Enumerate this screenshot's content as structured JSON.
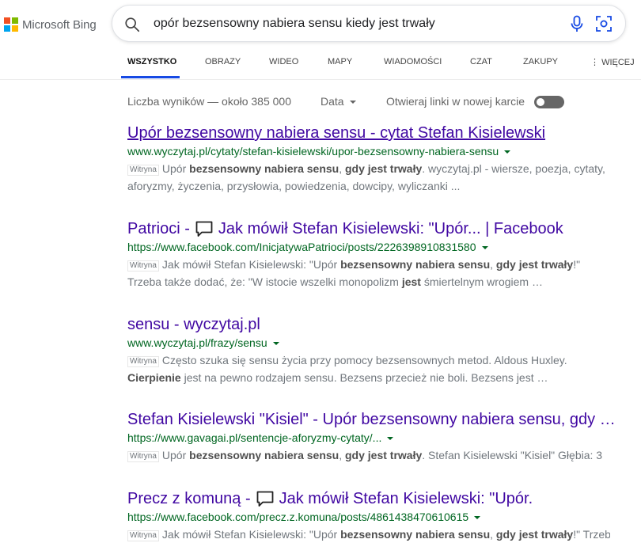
{
  "brand": {
    "name": "Microsoft Bing",
    "colors": [
      "#f25022",
      "#7fba00",
      "#00a4ef",
      "#ffb900"
    ]
  },
  "search": {
    "query": "opór bezsensowny nabiera sensu kiedy jest trwały",
    "icons": [
      "search-icon",
      "microphone-icon",
      "visual-search-icon"
    ]
  },
  "tabs": [
    {
      "label": "WSZYSTKO",
      "active": true
    },
    {
      "label": "OBRAZY"
    },
    {
      "label": "WIDEO"
    },
    {
      "label": "MAPY"
    },
    {
      "label": "WIADOMOŚCI"
    },
    {
      "label": "CZAT"
    },
    {
      "label": "ZAKUPY"
    },
    {
      "label": "WIĘCEJ"
    }
  ],
  "toolbar": {
    "result_count": "Liczba wyników — około 385 000",
    "date_label": "Data",
    "new_tab_label": "Otwieraj linki w nowej karcie",
    "new_tab_enabled": false
  },
  "colors": {
    "title": "#4007a2",
    "url": "#006621",
    "accent": "#174ae4"
  },
  "results": [
    {
      "title": "Upór bezsensowny nabiera sensu - cytat Stefan Kisielewski",
      "url": "www.wyczytaj.pl/cytaty/stefan-kisielewski/upor-bezsensowny-nabiera-sensu",
      "badge": "Witryna",
      "snippet": [
        {
          "t": "Upór "
        },
        {
          "t": "bezsensowny nabiera sensu",
          "b": true
        },
        {
          "t": ", "
        },
        {
          "t": "gdy jest trwały",
          "b": true
        },
        {
          "t": ". wyczytaj.pl - wiersze, poezja, cytaty, aforyzmy, życzenia, przysłowia, powiedzenia, dowcipy, wyliczanki ..."
        }
      ]
    },
    {
      "title_pre": "Patrioci -",
      "title_post": "Jak mówił Stefan Kisielewski: \"Upór... | Facebook",
      "url": "https://www.facebook.com/InicjatywaPatrioci/posts/2226398910831580",
      "badge": "Witryna",
      "snippet": [
        {
          "t": "Jak mówił Stefan Kisielewski: \"Upór "
        },
        {
          "t": "bezsensowny nabiera sensu",
          "b": true
        },
        {
          "t": ", "
        },
        {
          "t": "gdy jest trwały",
          "b": true
        },
        {
          "t": "!\" Trzeba także dodać, że: \"W istocie wszelki monopolizm "
        },
        {
          "t": "jest",
          "b": true
        },
        {
          "t": " śmiertelnym wrogiem …"
        }
      ]
    },
    {
      "title": "sensu - wyczytaj.pl",
      "url": "www.wyczytaj.pl/frazy/sensu",
      "badge": "Witryna",
      "snippet": [
        {
          "t": "Często szuka się sensu życia przy pomocy bezsensownych metod. Aldous Huxley. "
        },
        {
          "t": "Cierpienie",
          "b": true
        },
        {
          "t": " jest na pewno rodzajem sensu. Bezsens przecież nie boli. Bezsens jest …"
        }
      ]
    },
    {
      "title": "Stefan Kisielewski \"Kisiel\" - Upór bezsensowny nabiera sensu, gdy …",
      "url": "https://www.gavagai.pl/sentencje-aforyzmy-cytaty/...",
      "badge": "Witryna",
      "snippet": [
        {
          "t": "Upór "
        },
        {
          "t": "bezsensowny nabiera sensu",
          "b": true
        },
        {
          "t": ", "
        },
        {
          "t": "gdy jest trwały",
          "b": true
        },
        {
          "t": ". Stefan Kisielewski \"Kisiel\" Głębia: 3"
        }
      ]
    },
    {
      "title_pre": "Precz z komuną -",
      "title_post": "Jak mówił Stefan Kisielewski: \"Upór.",
      "url": "https://www.facebook.com/precz.z.komuna/posts/4861438470610615",
      "badge": "Witryna",
      "snippet": [
        {
          "t": "Jak mówił Stefan Kisielewski: \"Upór "
        },
        {
          "t": "bezsensowny nabiera sensu",
          "b": true
        },
        {
          "t": ", "
        },
        {
          "t": "gdy jest trwały",
          "b": true
        },
        {
          "t": "!\" Trzeba"
        }
      ]
    }
  ]
}
